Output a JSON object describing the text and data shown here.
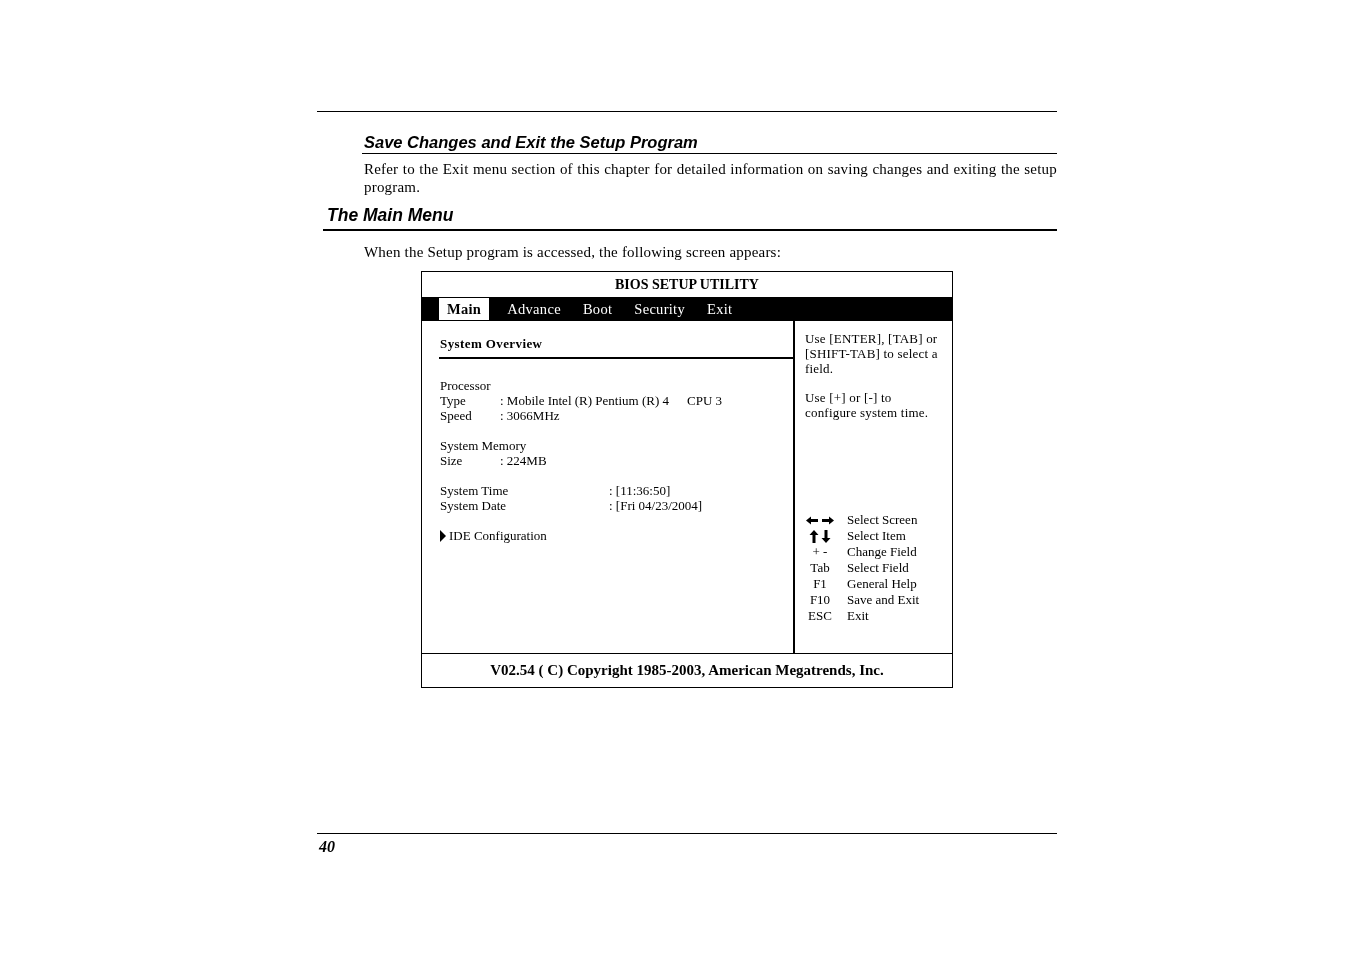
{
  "section": {
    "title": "Save Changes and Exit the Setup Program",
    "text": "Refer to the Exit menu section of this chapter for detailed information on saving changes and exiting the setup program."
  },
  "heading": "The Main Menu",
  "intro": "When the Setup program is accessed, the following screen appears:",
  "bios": {
    "title": "BIOS SETUP UTILITY",
    "tabs": [
      {
        "label": "Main",
        "selected": true
      },
      {
        "label": "Advance",
        "selected": false
      },
      {
        "label": "Boot",
        "selected": false
      },
      {
        "label": "Security",
        "selected": false
      },
      {
        "label": "Exit",
        "selected": false
      }
    ],
    "section_title": "System Overview",
    "groups": [
      {
        "kind": "info",
        "header": "Processor",
        "rows": [
          {
            "label": "Type",
            "value": ": Mobile Intel (R) Pentium (R) 4",
            "extra": "CPU 3"
          },
          {
            "label": "Speed",
            "value": ": 3066MHz"
          }
        ]
      },
      {
        "kind": "info",
        "header": "System Memory",
        "rows": [
          {
            "label": "Size",
            "value": ": 224MB"
          }
        ]
      },
      {
        "kind": "setting",
        "rows": [
          {
            "label": "System Time",
            "value": ": [11:36:50]"
          },
          {
            "label": "System Date",
            "value": ": [Fri 04/23/2004]"
          }
        ]
      }
    ],
    "submenus": [
      "IDE Configuration"
    ],
    "help": [
      "Use [ENTER], [TAB] or [SHIFT-TAB] to select a field.",
      "Use [+] or [-] to configure system time."
    ],
    "keys": [
      {
        "kind": "arrows-lr",
        "action": "Select Screen"
      },
      {
        "kind": "arrows-ud",
        "action": "Select Item"
      },
      {
        "kind": "text",
        "key": "+ -",
        "action": "Change Field"
      },
      {
        "kind": "text",
        "key": "Tab",
        "action": "Select Field"
      },
      {
        "kind": "text",
        "key": "F1",
        "action": "General Help"
      },
      {
        "kind": "text",
        "key": "F10",
        "action": "Save and Exit"
      },
      {
        "kind": "text",
        "key": "ESC",
        "action": "Exit"
      }
    ],
    "footer": "V02.54 ( C) Copyright 1985-2003, American Megatrends, Inc."
  },
  "page_number": "40"
}
